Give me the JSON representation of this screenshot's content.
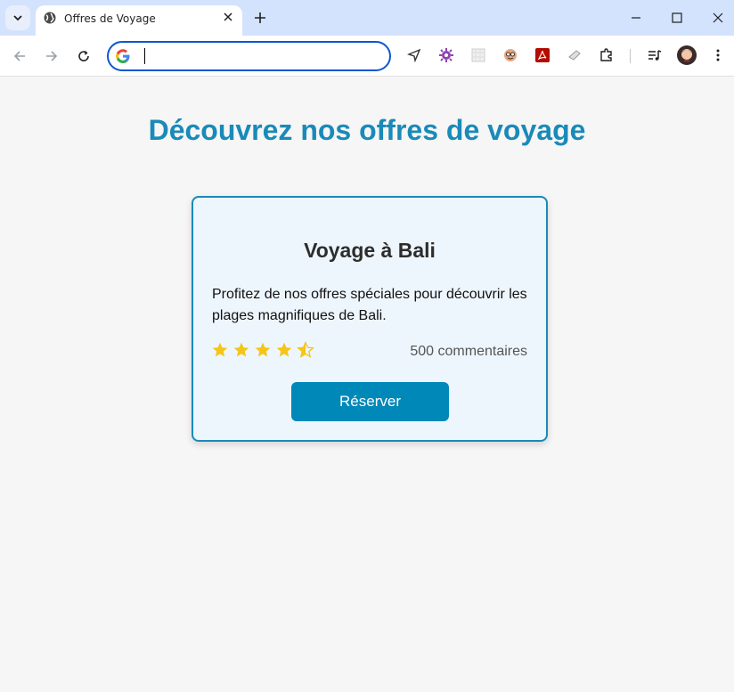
{
  "browser": {
    "tab_title": "Offres de Voyage",
    "address_value": "",
    "accent_color": "#0b57d0"
  },
  "page": {
    "heading": "Découvrez nos offres de voyage",
    "heading_color": "#1a8ab8",
    "card": {
      "title": "Voyage à Bali",
      "description": "Profitez de nos offres spéciales pour découvrir les plages magnifiques de Bali.",
      "rating": 4.5,
      "rating_max": 5,
      "star_color": "#f5c518",
      "reviews": "500 commentaires",
      "button_label": "Réserver",
      "button_color": "#0088b9"
    }
  }
}
